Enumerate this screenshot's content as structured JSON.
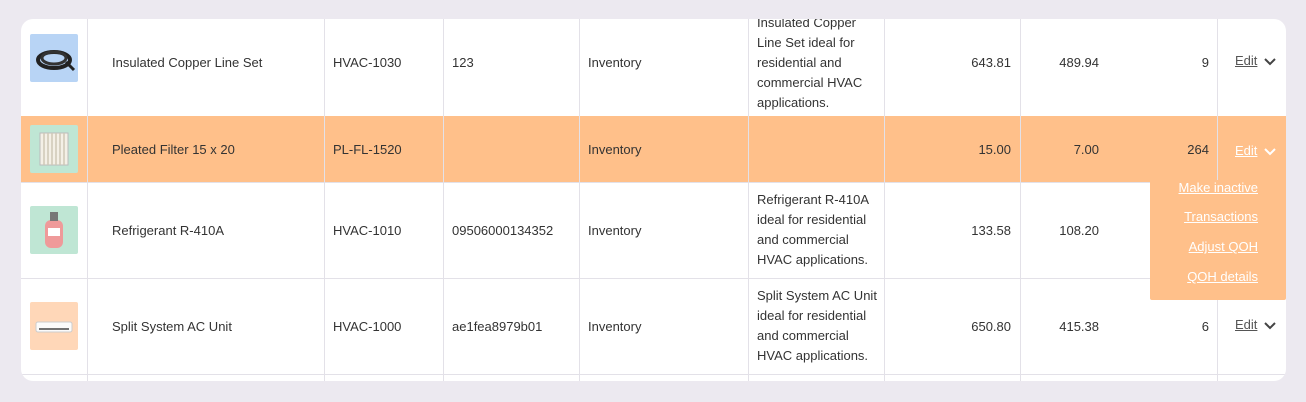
{
  "rows": [
    {
      "name": "Insulated Copper Line Set",
      "sku": "HVAC-1030",
      "barcode": "123",
      "type": "Inventory",
      "description": "Insulated Copper Line Set ideal for residential and commercial HVAC applications.",
      "price": "643.81",
      "cost": "489.94",
      "qoh": "9",
      "edit_label": "Edit",
      "thumb_icon": "copper-coil-icon"
    },
    {
      "name": "Pleated Filter 15 x 20",
      "sku": "PL-FL-1520",
      "barcode": "",
      "type": "Inventory",
      "description": "",
      "price": "15.00",
      "cost": "7.00",
      "qoh": "264",
      "edit_label": "Edit",
      "thumb_icon": "pleated-filter-icon"
    },
    {
      "name": "Refrigerant R-410A",
      "sku": "HVAC-1010",
      "barcode": "09506000134352",
      "type": "Inventory",
      "description": "Refrigerant R-410A ideal for residential and commercial HVAC applications.",
      "price": "133.58",
      "cost": "108.20",
      "qoh": "",
      "edit_label": "",
      "thumb_icon": "refrigerant-tank-icon"
    },
    {
      "name": "Split System AC Unit",
      "sku": "HVAC-1000",
      "barcode": "ae1fea8979b01",
      "type": "Inventory",
      "description": "Split System AC Unit ideal for residential and commercial HVAC applications.",
      "price": "650.80",
      "cost": "415.38",
      "qoh": "6",
      "edit_label": "Edit",
      "thumb_icon": "ac-unit-icon"
    }
  ],
  "row_menu": {
    "items": [
      "Make inactive",
      "Transactions",
      "Adjust QOH",
      "QOH details"
    ]
  },
  "colors": {
    "highlight": "#ffc08a",
    "thumb_blue": "#b8d4f5",
    "thumb_green": "#bfe6d4",
    "thumb_peach": "#ffd7b8"
  }
}
